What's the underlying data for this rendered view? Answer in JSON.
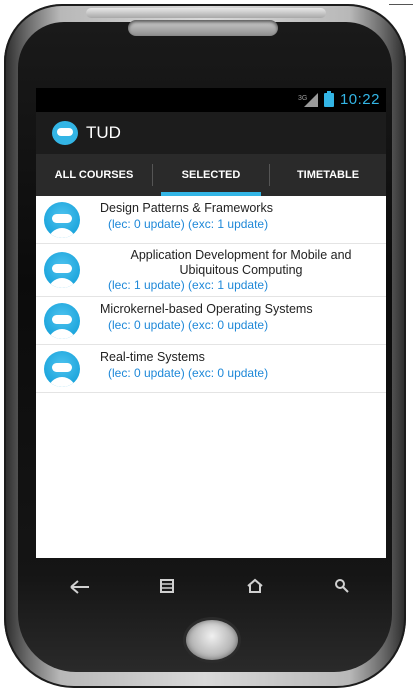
{
  "status": {
    "time": "10:22",
    "network": "3G"
  },
  "app": {
    "title": "TUD"
  },
  "tabs": [
    {
      "label": "ALL COURSES",
      "active": false
    },
    {
      "label": "SELECTED",
      "active": true
    },
    {
      "label": "TIMETABLE",
      "active": false
    }
  ],
  "courses": [
    {
      "name": "Design Patterns & Frameworks",
      "updates": "(lec: 0 update) (exc: 1 update)"
    },
    {
      "name": "Application Development for Mobile and Ubiquitous Computing",
      "updates": "(lec: 1 update) (exc: 1 update)"
    },
    {
      "name": "Microkernel-based Operating Systems",
      "updates": "(lec: 0 update) (exc: 0 update)"
    },
    {
      "name": "Real-time Systems",
      "updates": "(lec: 0 update) (exc: 0 update)"
    }
  ],
  "nav": {
    "back_icon": "back-arrow-icon",
    "recent_icon": "recent-apps-icon",
    "home_icon": "home-icon",
    "search_icon": "search-icon"
  },
  "colors": {
    "accent": "#33b5e5",
    "link": "#1e88d8"
  }
}
